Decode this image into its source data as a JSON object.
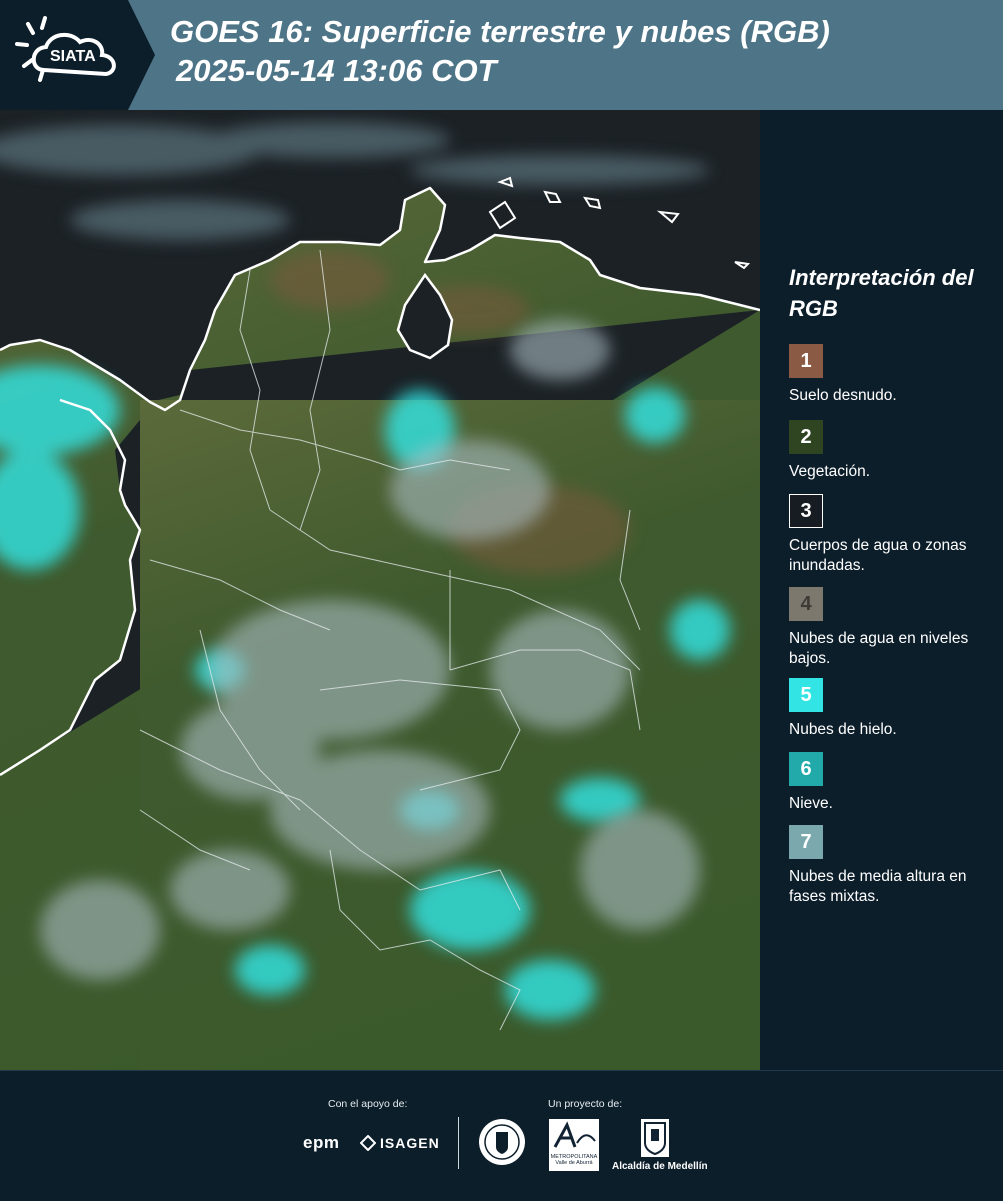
{
  "header": {
    "logo_text": "SIATA",
    "title_line1": "GOES 16: Superficie terrestre y nubes (RGB)",
    "title_line2": "2025-05-14 13:06 COT",
    "colors": {
      "bar": "#4e7587",
      "logo_panel": "#0d1e2b"
    }
  },
  "map": {
    "icon": "satellite-image",
    "colors": {
      "ocean": "#1b2125",
      "vegetation": "#3f5a2e",
      "ice_cloud": "#33e6e6",
      "coastline": "#ffffff"
    }
  },
  "legend": {
    "title": "Interpretación del RGB",
    "items": [
      {
        "number": "1",
        "label": "Suelo desnudo.",
        "color": "#8a5a44"
      },
      {
        "number": "2",
        "label": "Vegetación.",
        "color": "#2f4522"
      },
      {
        "number": "3",
        "label": "Cuerpos de agua o zonas inundadas.",
        "color": "#161c21"
      },
      {
        "number": "4",
        "label": "Nubes de agua en niveles bajos.",
        "color": "#7d786e"
      },
      {
        "number": "5",
        "label": "Nubes de hielo.",
        "color": "#33e4e4"
      },
      {
        "number": "6",
        "label": "Nieve.",
        "color": "#22a9aa"
      },
      {
        "number": "7",
        "label": "Nubes de media altura en fases mixtas.",
        "color": "#7aa8ad"
      }
    ]
  },
  "footer": {
    "support_label": "Con el apoyo de:",
    "project_label": "Un proyecto de:",
    "logos": {
      "epm": "epm",
      "isagen": "ISAGEN",
      "metropolitana": "METROPOLITANA Valle de Aburrá",
      "alcaldia": "Alcaldía de Medellín"
    }
  }
}
